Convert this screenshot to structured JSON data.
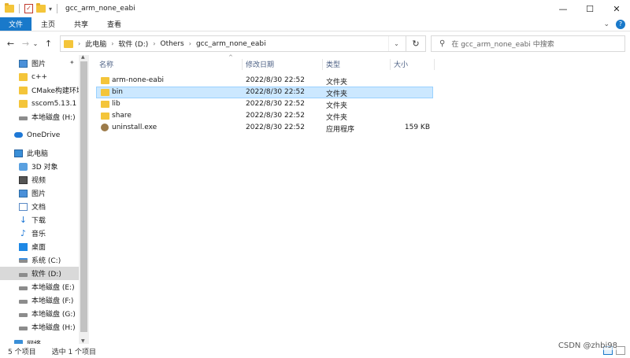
{
  "window": {
    "title": "gcc_arm_none_eabi",
    "controls": [
      "—",
      "☐",
      "✕"
    ]
  },
  "quick_access": {
    "arrow": "▾"
  },
  "ribbon": {
    "tabs": [
      "文件",
      "主页",
      "共享",
      "查看"
    ],
    "expand": "⌄",
    "help": "?"
  },
  "nav": {
    "back": "←",
    "forward": "→",
    "recent": "⌄",
    "up": "↑",
    "refresh": "↻"
  },
  "address": {
    "crumbs": [
      "此电脑",
      "软件 (D:)",
      "Others",
      "gcc_arm_none_eabi"
    ],
    "dropdown": "⌄"
  },
  "search": {
    "placeholder": "在 gcc_arm_none_eabi 中搜索",
    "icon": "search-icon"
  },
  "sidebar": {
    "items": [
      {
        "label": "图片",
        "icon": "picture-icon",
        "pinned": true
      },
      {
        "label": "c++",
        "icon": "folder-icon"
      },
      {
        "label": "CMake构建环境",
        "icon": "folder-icon"
      },
      {
        "label": "sscom5.13.1",
        "icon": "folder-icon"
      },
      {
        "label": "本地磁盘 (H:)",
        "icon": "drive-icon"
      },
      {
        "label": "OneDrive",
        "icon": "cloud-icon"
      },
      {
        "label": "此电脑",
        "icon": "computer-icon"
      },
      {
        "label": "3D 对象",
        "icon": "3d-objects-icon"
      },
      {
        "label": "视频",
        "icon": "video-icon"
      },
      {
        "label": "图片",
        "icon": "picture-icon"
      },
      {
        "label": "文档",
        "icon": "document-icon"
      },
      {
        "label": "下载",
        "icon": "download-icon"
      },
      {
        "label": "音乐",
        "icon": "music-icon"
      },
      {
        "label": "桌面",
        "icon": "desktop-icon"
      },
      {
        "label": "系统 (C:)",
        "icon": "system-drive-icon"
      },
      {
        "label": "软件 (D:)",
        "icon": "drive-icon",
        "selected": true
      },
      {
        "label": "本地磁盘 (E:)",
        "icon": "drive-icon"
      },
      {
        "label": "本地磁盘 (F:)",
        "icon": "drive-icon"
      },
      {
        "label": "本地磁盘 (G:)",
        "icon": "drive-icon"
      },
      {
        "label": "本地磁盘 (H:)",
        "icon": "drive-icon"
      },
      {
        "label": "网络",
        "icon": "network-icon"
      }
    ]
  },
  "list": {
    "columns": [
      "名称",
      "修改日期",
      "类型",
      "大小"
    ],
    "sort_arrow": "^",
    "rows": [
      {
        "name": "arm-none-eabi",
        "date": "2022/8/30 22:52",
        "type": "文件夹",
        "size": "",
        "icon": "folder-icon"
      },
      {
        "name": "bin",
        "date": "2022/8/30 22:52",
        "type": "文件夹",
        "size": "",
        "icon": "folder-icon",
        "selected": true
      },
      {
        "name": "lib",
        "date": "2022/8/30 22:52",
        "type": "文件夹",
        "size": "",
        "icon": "folder-icon"
      },
      {
        "name": "share",
        "date": "2022/8/30 22:52",
        "type": "文件夹",
        "size": "",
        "icon": "folder-icon"
      },
      {
        "name": "uninstall.exe",
        "date": "2022/8/30 22:52",
        "type": "应用程序",
        "size": "159 KB",
        "icon": "application-icon"
      }
    ]
  },
  "status": {
    "item_count": "5 个项目",
    "selected": "选中 1 个项目"
  },
  "watermark": "CSDN @zhbi98",
  "colors": {
    "accent": "#1979ca",
    "selection": "#cce8ff",
    "folder": "#f4c53a"
  }
}
